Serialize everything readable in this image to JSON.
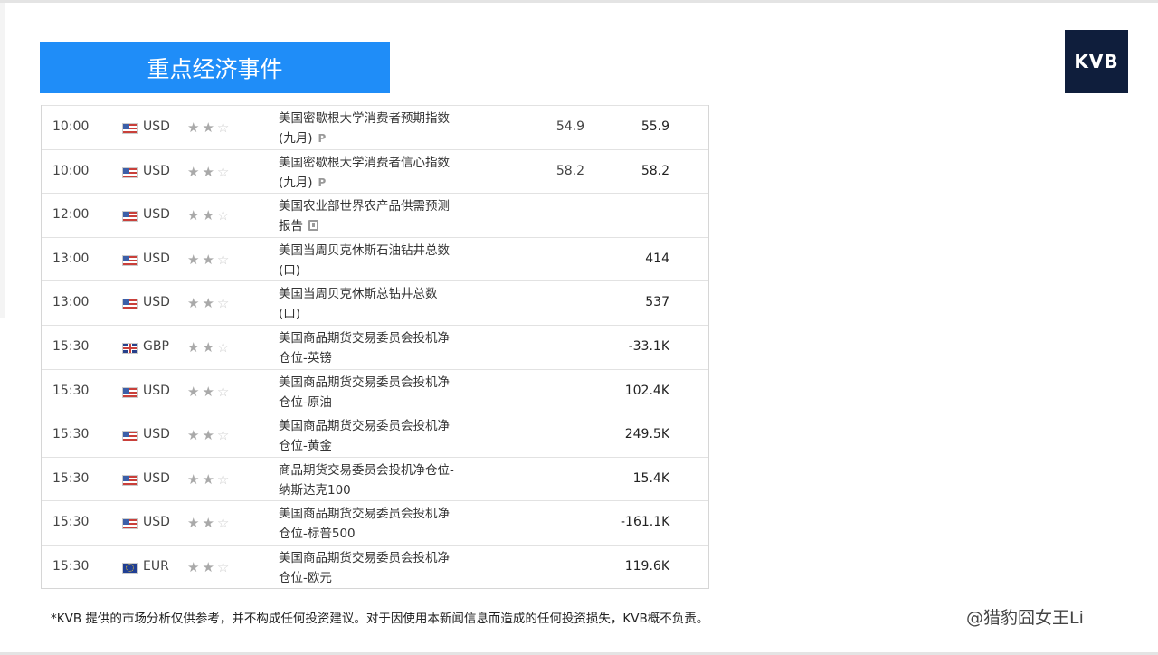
{
  "header": {
    "title": "重点经济事件",
    "logo_text": "KVB"
  },
  "events": [
    {
      "time": "10:00",
      "flag": "us-flag-icon",
      "currency": "USD",
      "stars": 2,
      "event_line1": "美国密歇根大学消费者预期指数",
      "event_line2": "(九月)",
      "tag": "P",
      "previous": "54.9",
      "value": "55.9"
    },
    {
      "time": "10:00",
      "flag": "us-flag-icon",
      "currency": "USD",
      "stars": 2,
      "event_line1": "美国密歇根大学消费者信心指数",
      "event_line2": "(九月)",
      "tag": "P",
      "previous": "58.2",
      "value": "58.2"
    },
    {
      "time": "12:00",
      "flag": "us-flag-icon",
      "currency": "USD",
      "stars": 2,
      "event_line1": "美国农业部世界农产品供需预测",
      "event_line2": "报告",
      "tag": "",
      "previous": "",
      "value": ""
    },
    {
      "time": "13:00",
      "flag": "us-flag-icon",
      "currency": "USD",
      "stars": 2,
      "event_line1": "美国当周贝克休斯石油钻井总数",
      "event_line2": "(口)",
      "tag": "",
      "previous": "",
      "value": "414"
    },
    {
      "time": "13:00",
      "flag": "us-flag-icon",
      "currency": "USD",
      "stars": 2,
      "event_line1": "美国当周贝克休斯总钻井总数",
      "event_line2": "(口)",
      "tag": "",
      "previous": "",
      "value": "537"
    },
    {
      "time": "15:30",
      "flag": "gb-flag-icon",
      "currency": "GBP",
      "stars": 2,
      "event_line1": "美国商品期货交易委员会投机净",
      "event_line2": "仓位-英镑",
      "tag": "",
      "previous": "",
      "value": "-33.1K"
    },
    {
      "time": "15:30",
      "flag": "us-flag-icon",
      "currency": "USD",
      "stars": 2,
      "event_line1": "美国商品期货交易委员会投机净",
      "event_line2": "仓位-原油",
      "tag": "",
      "previous": "",
      "value": "102.4K"
    },
    {
      "time": "15:30",
      "flag": "us-flag-icon",
      "currency": "USD",
      "stars": 2,
      "event_line1": "美国商品期货交易委员会投机净",
      "event_line2": "仓位-黄金",
      "tag": "",
      "previous": "",
      "value": "249.5K"
    },
    {
      "time": "15:30",
      "flag": "us-flag-icon",
      "currency": "USD",
      "stars": 2,
      "event_line1": "商品期货交易委员会投机净仓位-",
      "event_line2": "纳斯达克100",
      "tag": "",
      "previous": "",
      "value": "15.4K"
    },
    {
      "time": "15:30",
      "flag": "us-flag-icon",
      "currency": "USD",
      "stars": 2,
      "event_line1": "美国商品期货交易委员会投机净",
      "event_line2": "仓位-标普500",
      "tag": "",
      "previous": "",
      "value": "-161.1K"
    },
    {
      "time": "15:30",
      "flag": "eu-flag-icon",
      "currency": "EUR",
      "stars": 2,
      "event_line1": "美国商品期货交易委员会投机净",
      "event_line2": "仓位-欧元",
      "tag": "",
      "previous": "",
      "value": "119.6K"
    }
  ],
  "footer": {
    "disclaimer": "*KVB 提供的市场分析仅供参考，并不构成任何投资建议。对于因使用本新闻信息而造成的任何投资损失，KVB概不负责。",
    "watermark": "@猎豹囧女王Li"
  },
  "colors": {
    "banner": "#1f8df8",
    "logo_bg": "#0f1e3c"
  }
}
